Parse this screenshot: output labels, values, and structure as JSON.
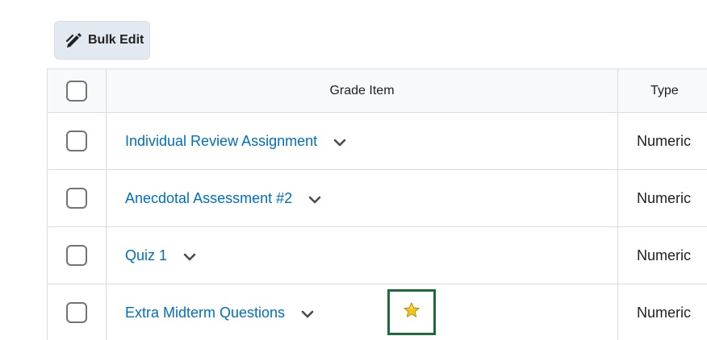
{
  "toolbar": {
    "bulk_edit_label": "Bulk Edit",
    "bulk_edit_icon": "pencil-edit-icon"
  },
  "table": {
    "headers": {
      "grade_item": "Grade Item",
      "type": "Type"
    },
    "rows": [
      {
        "name": "Individual Review Assignment",
        "type": "Numeric"
      },
      {
        "name": "Anecdotal Assessment #2",
        "type": "Numeric"
      },
      {
        "name": "Quiz 1",
        "type": "Numeric"
      },
      {
        "name": "Extra Midterm Questions",
        "type": "Numeric",
        "indicator_icon": "star-icon"
      }
    ]
  },
  "colors": {
    "link": "#006fbf",
    "highlight_box": "#1e6b3a",
    "star": "#f3c417",
    "button_bg": "#e3e9f1"
  }
}
